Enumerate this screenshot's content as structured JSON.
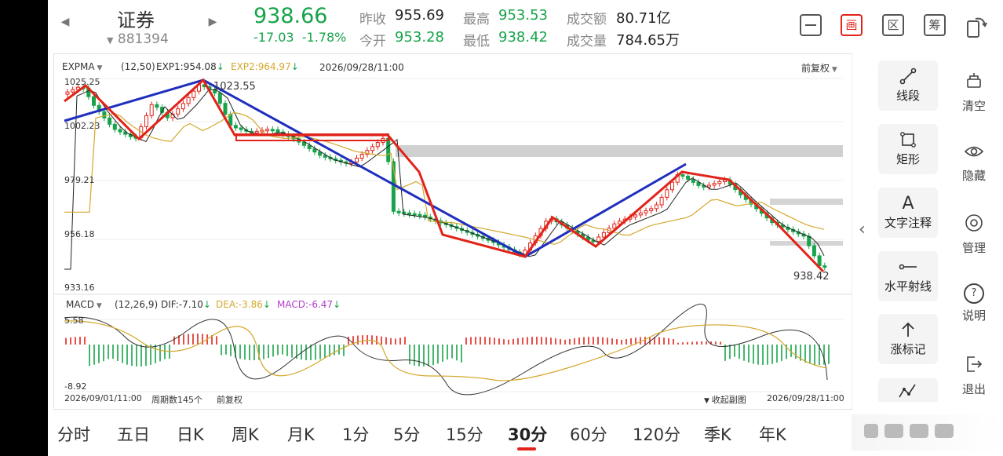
{
  "header": {
    "stock_name": "证券",
    "stock_code": "881394",
    "price": "938.66",
    "change": "-17.03",
    "change_pct": "-1.78%",
    "quotes": {
      "prev_close": {
        "label": "昨收",
        "value": "955.69"
      },
      "open": {
        "label": "今开",
        "value": "953.28"
      },
      "high": {
        "label": "最高",
        "value": "953.53"
      },
      "low": {
        "label": "最低",
        "value": "938.42"
      },
      "turnover": {
        "label": "成交额",
        "value": "80.71亿"
      },
      "volume": {
        "label": "成交量",
        "value": "784.65万"
      }
    },
    "toolbar_icons": [
      "minimize-icon",
      "draw-icon",
      "region-icon",
      "chips-icon",
      "rotate-icon"
    ],
    "draw_label": "画",
    "region_label": "区",
    "chips_label": "筹"
  },
  "chart": {
    "indicator": "EXPMA",
    "params": "(12,50)",
    "exp1": "EXP1:954.08",
    "exp2": "EXP2:964.97",
    "datetime": "2026/09/28/11:00",
    "adjust": "前复权",
    "y_ticks": [
      "1025.25",
      "1002.23",
      "979.21",
      "956.18",
      "933.16"
    ],
    "peak_label": "1023.55",
    "last_label": "938.42",
    "macd": {
      "name": "MACD",
      "params": "(12,26,9)",
      "dif": "DIF:-7.10",
      "dea": "DEA:-3.86",
      "macd": "MACD:-6.47",
      "y_max": "5.58",
      "y_min": "-8.92"
    },
    "footer": {
      "start": "2026/09/01/11:00",
      "period_count": "周期数145个",
      "adjust": "前复权",
      "collapse": "收起副图",
      "end": "2026/09/28/11:00"
    }
  },
  "side_tools": [
    {
      "label": "线段",
      "icon": "segment-icon"
    },
    {
      "label": "矩形",
      "icon": "rectangle-icon"
    },
    {
      "label": "文字注释",
      "icon": "text-annotation-icon",
      "glyph": "A"
    },
    {
      "label": "水平射线",
      "icon": "horizontal-ray-icon"
    },
    {
      "label": "涨标记",
      "icon": "up-mark-icon"
    }
  ],
  "side_actions": [
    {
      "label": "清空",
      "icon": "clear-icon"
    },
    {
      "label": "隐藏",
      "icon": "hide-icon"
    },
    {
      "label": "管理",
      "icon": "manage-icon"
    },
    {
      "label": "说明",
      "icon": "help-icon",
      "glyph": "?"
    },
    {
      "label": "退出",
      "icon": "exit-icon"
    }
  ],
  "periods": [
    "分时",
    "五日",
    "日K",
    "周K",
    "月K",
    "1分",
    "5分",
    "15分",
    "30分",
    "60分",
    "120分",
    "季K",
    "年K"
  ],
  "active_period": "30分",
  "colors": {
    "up": "#e2231a",
    "down": "#17a34a",
    "trend_line": "#1f2fbd",
    "dea_line": "#d4a72c",
    "dif_line": "#333333"
  }
}
